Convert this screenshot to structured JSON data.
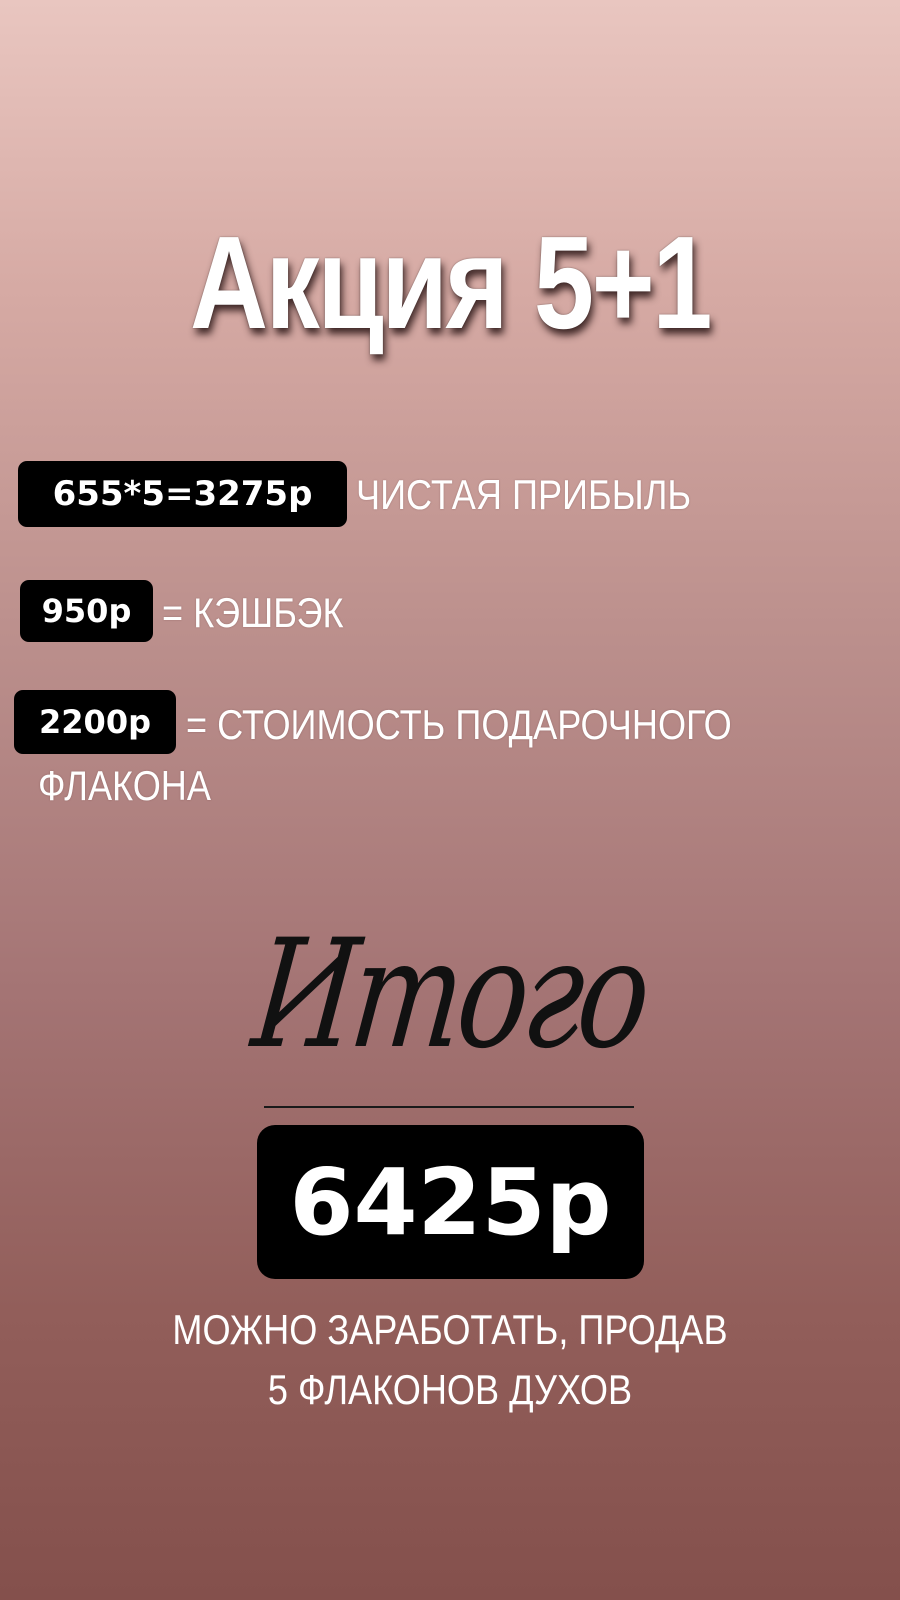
{
  "title": "Акция 5+1",
  "rows": [
    {
      "badge": "655*5=3275р",
      "text": "ЧИСТАЯ ПРИБЫЛЬ"
    },
    {
      "badge": "950р",
      "text": "= КЭШБЭК"
    },
    {
      "badge": "2200р",
      "text": "= СТОИМОСТЬ ПОДАРОЧНОГО",
      "text_line2": "ФЛАКОНА"
    }
  ],
  "total": {
    "heading": "Итого",
    "amount": "6425р"
  },
  "footer": {
    "line1": "МОЖНО ЗАРАБОТАТЬ, ПРОДАВ",
    "line2": "5 ФЛАКОНОВ ДУХОВ"
  },
  "colors": {
    "background_top": "#e9c6c0",
    "background_bottom": "#84504c",
    "badge": "#000000",
    "text": "#ffffff",
    "script_text": "#111111"
  }
}
